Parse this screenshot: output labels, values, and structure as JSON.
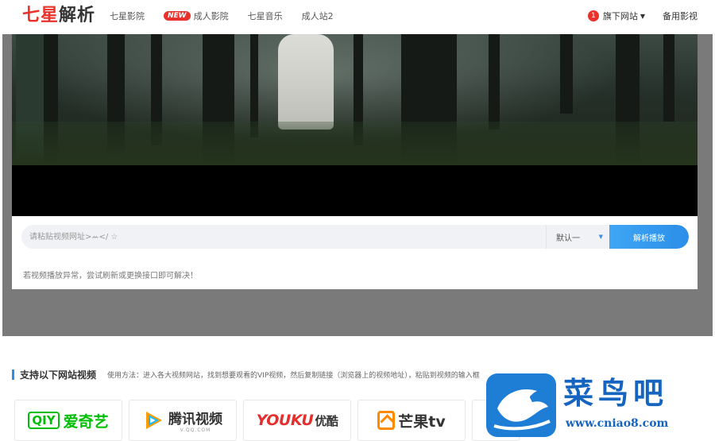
{
  "nav": {
    "logo_red": "七星",
    "logo_dark": "解析",
    "links": [
      {
        "label": "七星影院"
      },
      {
        "label": "成人影院",
        "badge": "NEW"
      },
      {
        "label": "七星音乐"
      },
      {
        "label": "成人站2"
      }
    ],
    "right": {
      "download_count": "1",
      "download_label": "旗下网站",
      "backup_label": "备用影视"
    }
  },
  "player": {
    "input_placeholder": "请粘贴视频网址>ꕀ</ ☆",
    "select_value": "默认一",
    "parse_button": "解析播放",
    "hint": "若视频播放异常，尝试刷新或更换接口即可解决！"
  },
  "sites_section": {
    "title": "支持以下网站视频",
    "desc": "使用方法：进入各大视频网站，找到想要观看的VIP视频，然后复制链接（浏览器上的视频地址），粘贴到视频的输入框",
    "sites": [
      {
        "box": "QIY",
        "name": "爱奇艺"
      },
      {
        "name": "腾讯视频",
        "sub": "V.QQ.COM"
      },
      {
        "en": "YOUKU",
        "zh": "优酷"
      },
      {
        "name": "芒果tv"
      }
    ]
  },
  "watermark": {
    "text": "菜鸟吧",
    "url": "www.cniao8.com"
  },
  "colors": {
    "brand_red": "#e8322b",
    "accent_blue": "#2b8ee8",
    "iqiyi_green": "#00be06",
    "youku_red": "#e62e2e",
    "mango_orange": "#ff8a00",
    "watermark_blue": "#1565c0"
  }
}
